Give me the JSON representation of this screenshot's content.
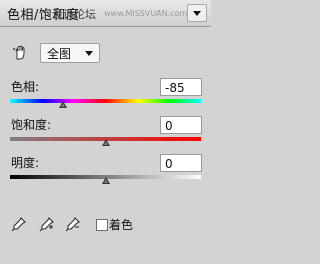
{
  "header": {
    "title": "色相/饱和度",
    "overlay_text": "设计论坛",
    "watermark": "www.MISSVUAN.com",
    "menu_icon": "chevron-down-icon"
  },
  "controls": {
    "edit_tool_icon": "hand-adjust-icon",
    "channel_select": {
      "selected": "全图",
      "icon": "chevron-down-icon"
    }
  },
  "sliders": [
    {
      "label": "色相:",
      "value": "-85",
      "position": 0.2764,
      "track": "hue-rainbow"
    },
    {
      "label": "饱和度:",
      "value": "0",
      "position": 0.5,
      "track": "gray-to-red"
    },
    {
      "label": "明度:",
      "value": "0",
      "position": 0.5,
      "track": "black-to-white"
    }
  ],
  "footer": {
    "eyedropper_icons": [
      "eyedropper-icon",
      "eyedropper-plus-icon",
      "eyedropper-minus-icon"
    ],
    "colorize": {
      "label": "着色",
      "checked": false
    }
  }
}
